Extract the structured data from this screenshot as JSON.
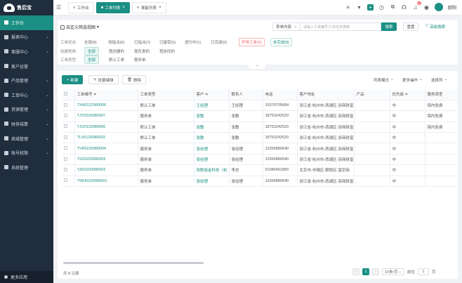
{
  "brand": {
    "name": "售后宝"
  },
  "sidebar": {
    "items": [
      {
        "label": "工作台",
        "chev": false,
        "active": true
      },
      {
        "label": "报表中心",
        "chev": true
      },
      {
        "label": "客服中心",
        "chev": true
      },
      {
        "label": "客户运营",
        "chev": false
      },
      {
        "label": "产品管理",
        "chev": true
      },
      {
        "label": "工单中心",
        "chev": true
      },
      {
        "label": "资源管理",
        "chev": true
      },
      {
        "label": "财务结算",
        "chev": true
      },
      {
        "label": "商城管理",
        "chev": true
      },
      {
        "label": "账号权限",
        "chev": true
      },
      {
        "label": "系统管理",
        "chev": false
      }
    ],
    "footer": "更多应用"
  },
  "tabs": [
    {
      "label": "工作台",
      "closable": false,
      "active": false
    },
    {
      "label": "工单列表",
      "closable": true,
      "active": true
    },
    {
      "label": "事能列表",
      "closable": true,
      "active": false
    }
  ],
  "topbar": {
    "notif_count": "12",
    "username": "欧阳"
  },
  "filter": {
    "custom_view": "自定义筛选视图",
    "search_field": "表单内容",
    "search_placeholder": "请输入工单编号/工单任务搜索",
    "search_btn": "搜索",
    "reset_btn": "重置",
    "advanced": "高级搜索",
    "rows": [
      {
        "label": "工单状态:",
        "options": [
          {
            "text": "全部(8)"
          },
          {
            "text": "待指派(0)"
          },
          {
            "text": "已指派(7)"
          },
          {
            "text": "已接受(0)"
          },
          {
            "text": "进行中(1)"
          },
          {
            "text": "已完成(0)"
          },
          {
            "text": "异常工单(0)",
            "style": "danger"
          },
          {
            "text": "未完成(8)",
            "style": "teal"
          }
        ]
      },
      {
        "label": "创建视角:",
        "options": [
          {
            "text": "全部",
            "style": "sel"
          },
          {
            "text": "我创建的"
          },
          {
            "text": "我负责的"
          },
          {
            "text": "我协同的"
          }
        ]
      },
      {
        "label": "工单类型:",
        "options": [
          {
            "text": "全部",
            "style": "sel"
          },
          {
            "text": "默认工单"
          },
          {
            "text": "服务单"
          }
        ]
      }
    ]
  },
  "toolbar": {
    "new": "新建",
    "batch_edit": "批量编辑",
    "delete": "删除",
    "list_mode": "列表模式",
    "more_ops": "更多操作",
    "select_cols": "选择列"
  },
  "table": {
    "headers": [
      "工单编号 ≑",
      "工单类型",
      "客户 ≑",
      "联系人",
      "电话",
      "客户地址",
      "产品",
      "优先级 ≑",
      "服务类型"
    ],
    "rows": [
      [
        "TXH0122080008",
        "默认工单",
        "王经理",
        "王经理",
        "15376705684",
        "浙江省-杭州市-西湖区-浙商财富",
        "",
        "中",
        "保内免费"
      ],
      [
        "TJY0220080007",
        "服务单",
        "张敷",
        "张敷",
        "18753242520",
        "浙江省-杭州市-西湖区-浙商财富",
        "",
        "中",
        "保内免费"
      ],
      [
        "TJU0120080006",
        "默认工单",
        "张敷",
        "张敷",
        "18753242520",
        "浙江省-杭州市-西湖区-浙商财富",
        "",
        "中",
        "保内免费"
      ],
      [
        "TLV0120080003",
        "默认工单",
        "张敷",
        "张敷",
        "18753242520",
        "浙江省-杭州市-西湖区-浙商财富",
        "",
        "中",
        ""
      ],
      [
        "TVR0220080004",
        "服务单",
        "张经理",
        "张经理",
        "13356880540",
        "浙江省-杭州市-西湖区-浙商财富",
        "",
        "中",
        ""
      ],
      [
        "TSZ0220080003",
        "服务单",
        "张经理",
        "张经理",
        "13356880540",
        "浙江省-杭州市-西湖区-浙商财富",
        "",
        "中",
        ""
      ],
      [
        "TZE0220080002",
        "服务单",
        "改联成金科技（杭",
        "李总",
        "01086461890",
        "北京市-市辖区-朝阳区-望京街",
        "",
        "中",
        ""
      ],
      [
        "TWH0220080001",
        "服务单",
        "张经理",
        "张经理",
        "13356880540",
        "浙江省-杭州市-西湖区-浙商财富",
        "",
        "中",
        ""
      ]
    ]
  },
  "pagination": {
    "total": "共 8 记录",
    "current": "1",
    "page_size": "10条/页",
    "goto_label": "前往",
    "goto_value": "1",
    "goto_suffix": "页"
  }
}
